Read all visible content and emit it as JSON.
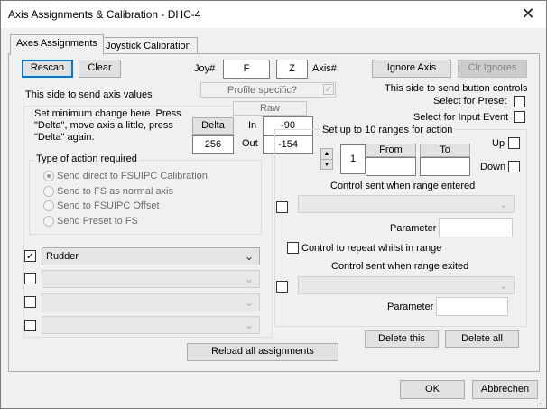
{
  "window": {
    "title": "Axis Assignments & Calibration - DHC-4"
  },
  "tabs": [
    {
      "label": "Axes Assignments"
    },
    {
      "label": "Joystick Calibration"
    }
  ],
  "toolbar": {
    "rescan": "Rescan",
    "clear": "Clear",
    "joy_label": "Joy#",
    "joy_value": "F",
    "axis_value": "Z",
    "axis_label": "Axis#",
    "ignore_axis": "Ignore Axis",
    "clr_ignores": "Clr Ignores"
  },
  "left": {
    "send_axis_values": "This side to send axis values",
    "profile_specific": "Profile specific?",
    "raw": "Raw",
    "min_change_text": [
      "Set minimum change here.  Press",
      "\"Delta\", move axis a little,  press",
      "\"Delta\" again."
    ],
    "delta_button": "Delta",
    "delta_value": "256",
    "in_label": "In",
    "in_value": "-90",
    "out_label": "Out",
    "out_value": "-154",
    "action_group_title": "Type of action required",
    "actions": [
      {
        "label": "Send direct to FSUIPC Calibration"
      },
      {
        "label": "Send to FS as normal axis"
      },
      {
        "label": "Send to FSUIPC Offset"
      },
      {
        "label": "Send Preset to FS"
      }
    ],
    "assignments": [
      {
        "checked": true,
        "value": "Rudder"
      },
      {
        "checked": false,
        "value": ""
      },
      {
        "checked": false,
        "value": ""
      },
      {
        "checked": false,
        "value": ""
      }
    ]
  },
  "right": {
    "send_button_controls": "This side to send button controls",
    "select_for_preset": "Select for Preset",
    "select_for_input_event": "Select for Input Event",
    "ranges_label": "Set up to 10 ranges for action",
    "range_number": "1",
    "from_label": "From",
    "to_label": "To",
    "up_label": "Up",
    "down_label": "Down",
    "control_entered": "Control sent when range entered",
    "parameter_label": "Parameter",
    "repeat_label": "Control to repeat whilst in range",
    "control_exited": "Control sent when range exited",
    "parameter_label2": "Parameter",
    "delete_this": "Delete this",
    "delete_all": "Delete all"
  },
  "reload": "Reload all assignments",
  "footer": {
    "ok": "OK",
    "cancel": "Abbrechen"
  }
}
